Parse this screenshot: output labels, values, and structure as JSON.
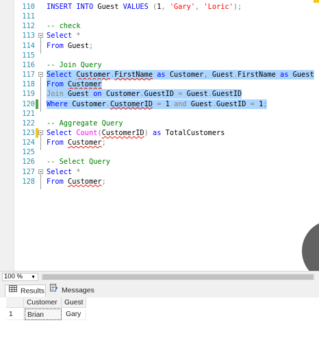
{
  "editor": {
    "lines": [
      {
        "n": "110",
        "segs": [
          [
            "kw",
            "INSERT INTO "
          ],
          [
            "",
            "Guest "
          ],
          [
            "kw",
            "VALUES "
          ],
          [
            "gy",
            "("
          ],
          [
            "",
            "1"
          ],
          [
            "gy",
            ", "
          ],
          [
            "str",
            "'Gary'"
          ],
          [
            "gy",
            ", "
          ],
          [
            "str",
            "'Loric'"
          ],
          [
            "gy",
            ");"
          ]
        ]
      },
      {
        "n": "111",
        "segs": []
      },
      {
        "n": "112",
        "segs": [
          [
            "cm",
            "-- check"
          ]
        ]
      },
      {
        "n": "113",
        "segs": [
          [
            "kw",
            "Select "
          ],
          [
            "gy",
            "*"
          ]
        ]
      },
      {
        "n": "114",
        "segs": [
          [
            "kw",
            "From "
          ],
          [
            "",
            "Guest"
          ],
          [
            "gy",
            ";"
          ]
        ]
      },
      {
        "n": "115",
        "segs": []
      },
      {
        "n": "116",
        "segs": [
          [
            "cm",
            "-- Join Query"
          ]
        ]
      },
      {
        "n": "117",
        "segs": [
          [
            "kw",
            "Select "
          ],
          [
            "sq",
            "Customer"
          ],
          [
            "gy",
            "."
          ],
          [
            "sq",
            "FirstName"
          ],
          [
            "kw",
            " as "
          ],
          [
            "",
            "Customer"
          ],
          [
            "gy",
            ", "
          ],
          [
            "",
            "Guest"
          ],
          [
            "gy",
            "."
          ],
          [
            "",
            "FirstName"
          ],
          [
            "kw",
            " as "
          ],
          [
            "",
            "Guest"
          ]
        ]
      },
      {
        "n": "118",
        "segs": [
          [
            "kw",
            "From "
          ],
          [
            "sq",
            "Customer"
          ]
        ]
      },
      {
        "n": "119",
        "segs": [
          [
            "gy",
            "Join "
          ],
          [
            "",
            "Guest "
          ],
          [
            "kw",
            "on "
          ],
          [
            "",
            "Customer"
          ],
          [
            "gy",
            "."
          ],
          [
            "",
            "GuestID "
          ],
          [
            "gy",
            "= "
          ],
          [
            "",
            "Guest"
          ],
          [
            "gy",
            "."
          ],
          [
            "",
            "GuestID"
          ]
        ]
      },
      {
        "n": "120",
        "segs": [
          [
            "kw",
            "Where "
          ],
          [
            "",
            "Customer"
          ],
          [
            "gy",
            "."
          ],
          [
            "sq",
            "CustomerID"
          ],
          [
            "gy",
            " = "
          ],
          [
            "",
            "1 "
          ],
          [
            "gy",
            "and "
          ],
          [
            "",
            "Guest"
          ],
          [
            "gy",
            "."
          ],
          [
            "",
            "GuestID "
          ],
          [
            "gy",
            "= "
          ],
          [
            "",
            "1"
          ],
          [
            "gy",
            ";"
          ]
        ]
      },
      {
        "n": "121",
        "segs": []
      },
      {
        "n": "122",
        "segs": [
          [
            "cm",
            "-- Aggregate Query"
          ]
        ]
      },
      {
        "n": "123",
        "segs": [
          [
            "kw",
            "Select "
          ],
          [
            "fn",
            "Count"
          ],
          [
            "gy",
            "("
          ],
          [
            "sq",
            "CustomerID"
          ],
          [
            "gy",
            ")"
          ],
          [
            "kw",
            " as "
          ],
          [
            "",
            "TotalCustomers"
          ]
        ]
      },
      {
        "n": "124",
        "segs": [
          [
            "kw",
            "From "
          ],
          [
            "sq",
            "Customer"
          ],
          [
            "gy",
            ";"
          ]
        ]
      },
      {
        "n": "125",
        "segs": []
      },
      {
        "n": "126",
        "segs": [
          [
            "cm",
            "-- Select Query"
          ]
        ]
      },
      {
        "n": "127",
        "segs": [
          [
            "kw",
            "Select "
          ],
          [
            "gy",
            "*"
          ]
        ]
      },
      {
        "n": "128",
        "segs": [
          [
            "kw",
            "From "
          ],
          [
            "sq",
            "Customer"
          ],
          [
            "gy",
            ";"
          ]
        ]
      }
    ]
  },
  "zoom": {
    "value": "100 %"
  },
  "tabs": {
    "results_label": "Results",
    "messages_label": "Messages"
  },
  "grid": {
    "columns": [
      "Customer",
      "Guest"
    ],
    "rows": [
      {
        "num": "1",
        "cells": [
          "Brian",
          "Gary"
        ]
      }
    ]
  },
  "colors": {
    "line_number": "#2b91af",
    "keyword": "#0000ff",
    "comment": "#008000",
    "string": "#ff0000",
    "selection": "#add6ff",
    "changed_saved": "#57a64a",
    "changed_unsaved": "#f5c518"
  }
}
